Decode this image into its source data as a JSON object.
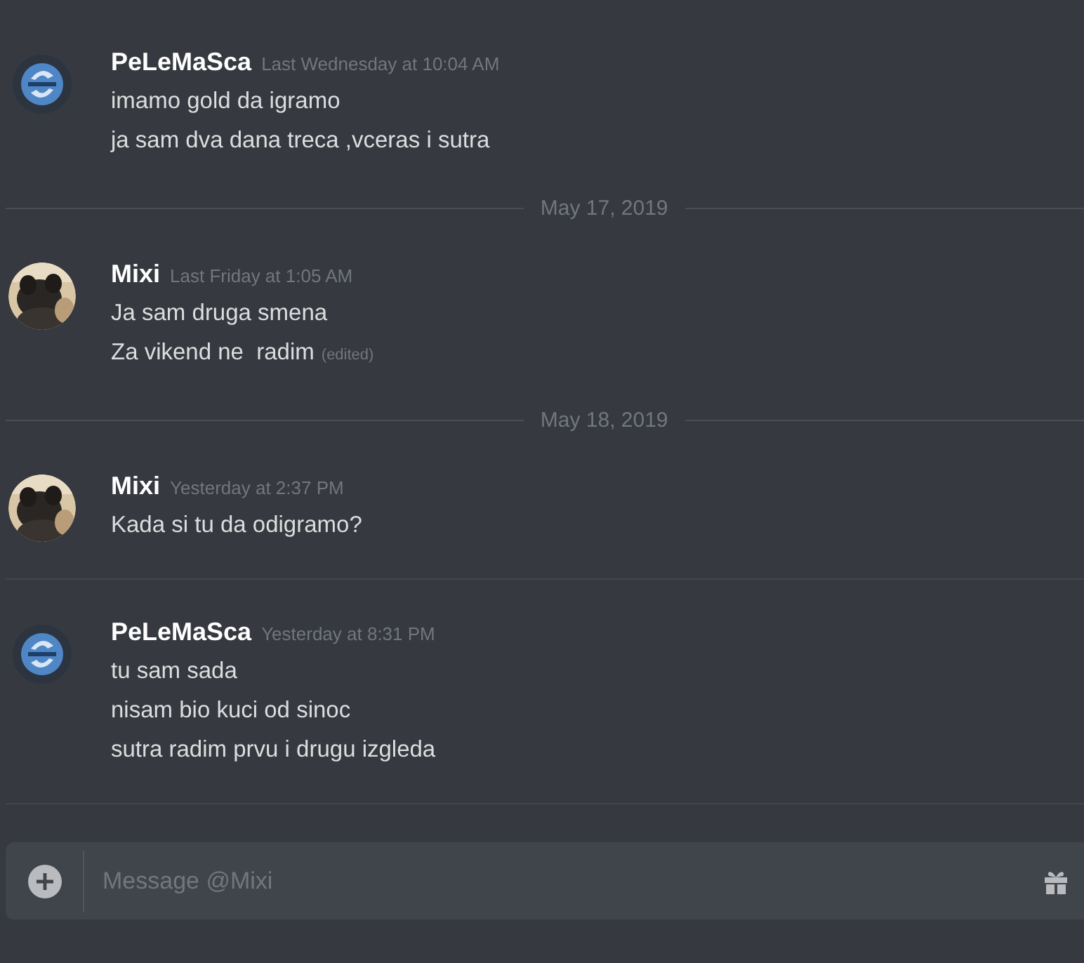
{
  "items": [
    {
      "kind": "message",
      "author": "PeLeMaSca",
      "timestamp": "Last Wednesday at 10:04 AM",
      "avatar": {
        "kind": "logo"
      },
      "lines": [
        {
          "text": "imamo gold da igramo"
        },
        {
          "text": "ja sam dva dana treca ,vceras i sutra"
        }
      ]
    },
    {
      "kind": "date_divider",
      "label": "May 17, 2019"
    },
    {
      "kind": "message",
      "author": "Mixi",
      "timestamp": "Last Friday at 1:05 AM",
      "avatar": {
        "kind": "picture"
      },
      "lines": [
        {
          "text": "Ja sam druga smena"
        },
        {
          "text": "Za vikend ne  radim",
          "edited_label": "(edited)"
        }
      ]
    },
    {
      "kind": "date_divider",
      "label": "May 18, 2019"
    },
    {
      "kind": "message",
      "author": "Mixi",
      "timestamp": "Yesterday at 2:37 PM",
      "avatar": {
        "kind": "picture"
      },
      "lines": [
        {
          "text": "Kada si tu da odigramo?"
        }
      ]
    },
    {
      "kind": "separator"
    },
    {
      "kind": "message",
      "author": "PeLeMaSca",
      "timestamp": "Yesterday at 8:31 PM",
      "avatar": {
        "kind": "logo"
      },
      "lines": [
        {
          "text": "tu sam sada"
        },
        {
          "text": "nisam bio kuci od sinoc"
        },
        {
          "text": "sutra radim prvu i drugu izgleda"
        }
      ]
    },
    {
      "kind": "separator"
    }
  ],
  "composer": {
    "placeholder": "Message @Mixi"
  }
}
